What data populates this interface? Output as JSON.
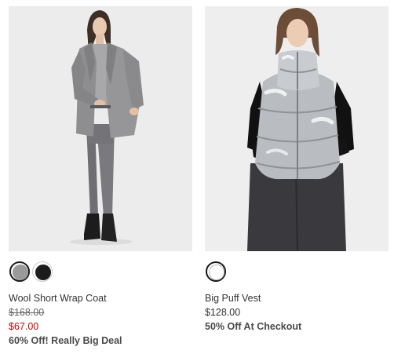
{
  "products": [
    {
      "image_alt": "Wool Short Wrap Coat",
      "name": "Wool Short Wrap Coat",
      "original_price": "$168.00",
      "sale_price": "$67.00",
      "sale_color": "#d00000",
      "promo": "60% Off! Really Big Deal",
      "swatches": [
        {
          "color": "#9a9a9a",
          "selected": true
        },
        {
          "color": "#1c1c1c",
          "selected": false
        }
      ]
    },
    {
      "image_alt": "Big Puff Vest",
      "name": "Big Puff Vest",
      "price": "$128.00",
      "promo": "50% Off At Checkout",
      "swatches": [
        {
          "color": "#ffffff",
          "selected": true
        }
      ]
    }
  ]
}
